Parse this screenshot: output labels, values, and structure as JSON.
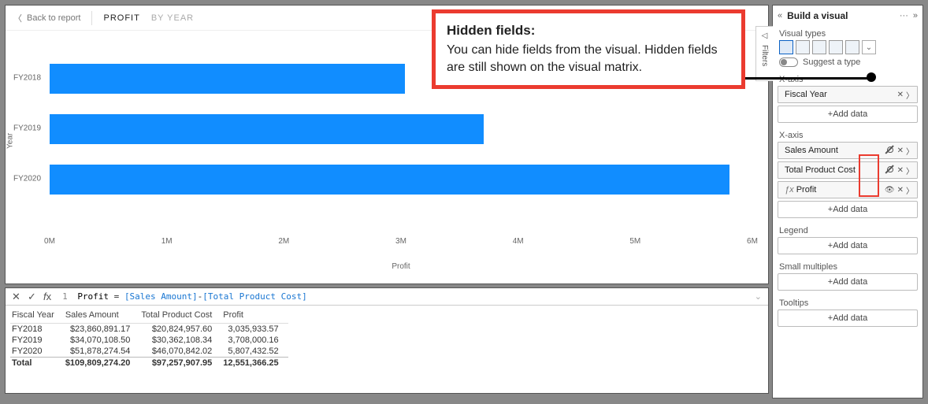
{
  "header": {
    "back_label": "Back to report",
    "breadcrumb_active": "PROFIT",
    "breadcrumb_secondary": "BY YEAR"
  },
  "chart": {
    "y_axis_label": "Year",
    "x_axis_label": "Profit"
  },
  "chart_data": {
    "type": "bar",
    "orientation": "horizontal",
    "categories": [
      "FY2018",
      "FY2019",
      "FY2020"
    ],
    "values": [
      3035933.57,
      3708000.16,
      5807432.52
    ],
    "xlabel": "Profit",
    "ylabel": "Year",
    "xlim": [
      0,
      6000000
    ],
    "xticks": [
      0,
      1000000,
      2000000,
      3000000,
      4000000,
      5000000,
      6000000
    ],
    "xtick_labels": [
      "0M",
      "1M",
      "2M",
      "3M",
      "4M",
      "5M",
      "6M"
    ]
  },
  "callout": {
    "title": "Hidden fields:",
    "body": "You can hide fields from the visual. Hidden fields are still shown on the visual matrix."
  },
  "formula": {
    "line_number": "1",
    "raw": "Profit = [Sales Amount]-[Total Product Cost]",
    "name": "Profit",
    "ref1": "[Sales Amount]",
    "ref2": "[Total Product Cost]"
  },
  "table": {
    "headers": [
      "Fiscal Year",
      "Sales Amount",
      "Total Product Cost",
      "Profit"
    ],
    "rows": [
      [
        "FY2018",
        "$23,860,891.17",
        "$20,824,957.60",
        "3,035,933.57"
      ],
      [
        "FY2019",
        "$34,070,108.50",
        "$30,362,108.34",
        "3,708,000.16"
      ],
      [
        "FY2020",
        "$51,878,274.54",
        "$46,070,842.02",
        "5,807,432.52"
      ]
    ],
    "total": [
      "Total",
      "$109,809,274.20",
      "$97,257,907.95",
      "12,551,366.25"
    ]
  },
  "pane": {
    "title": "Build a visual",
    "filters_label": "Filters",
    "visual_types_label": "Visual types",
    "suggest_label": "Suggest a type",
    "add_data_label": "+Add data",
    "wells": {
      "yaxis": {
        "label": "X-axis",
        "fields": [
          "Fiscal Year"
        ]
      },
      "xaxis": {
        "label": "X-axis",
        "fields": [
          {
            "name": "Sales Amount",
            "hidden": true
          },
          {
            "name": "Total Product Cost",
            "hidden": true
          },
          {
            "name": "Profit",
            "hidden": false,
            "calc": true
          }
        ]
      },
      "legend": {
        "label": "Legend"
      },
      "small_multiples": {
        "label": "Small multiples"
      },
      "tooltips": {
        "label": "Tooltips"
      }
    }
  }
}
